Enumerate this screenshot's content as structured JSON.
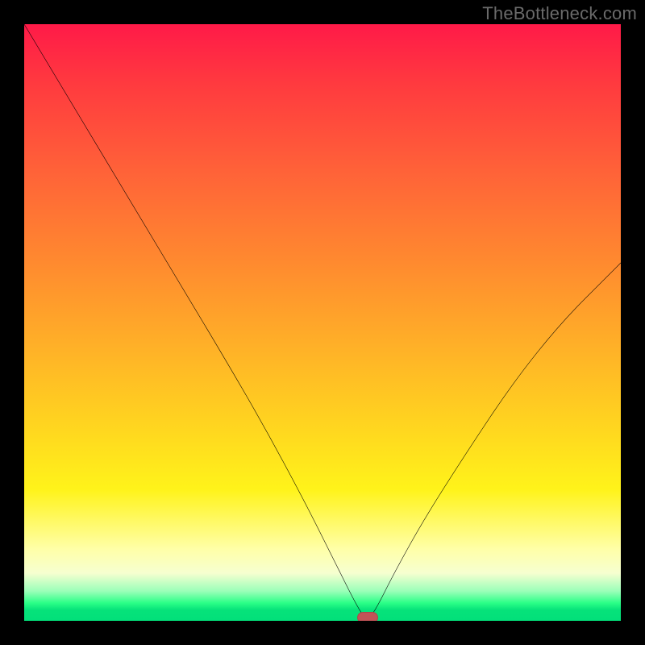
{
  "watermark": "TheBottleneck.com",
  "colors": {
    "page_bg": "#000000",
    "gradient_top": "#ff1a48",
    "gradient_mid": "#ffd71f",
    "gradient_bottom": "#02e07a",
    "curve": "#000000",
    "marker": "#c25357"
  },
  "chart_data": {
    "type": "line",
    "title": "",
    "xlabel": "",
    "ylabel": "",
    "xlim": [
      0,
      100
    ],
    "ylim": [
      0,
      100
    ],
    "series": [
      {
        "name": "bottleneck-curve",
        "x": [
          0,
          6,
          12,
          18,
          24,
          27,
          33,
          40,
          47,
          52,
          56,
          57.5,
          59,
          62,
          67,
          74,
          82,
          90,
          98,
          100
        ],
        "y": [
          100,
          90,
          80,
          70,
          60,
          55,
          45,
          33,
          20,
          10,
          2,
          0,
          2,
          8,
          17,
          28,
          40,
          50,
          58,
          60
        ]
      }
    ],
    "marker": {
      "x": 57.5,
      "y": 0,
      "shape": "rounded-rect"
    },
    "notes": "Background encodes bottleneck severity from red (100) down to green (0). Black V-shaped curve has its minimum at roughly x≈58 where the marker sits; left arm starts near 100 at x=0 and right arm rises to ≈60 at x=100. Values are visual estimates (no axis ticks present)."
  }
}
